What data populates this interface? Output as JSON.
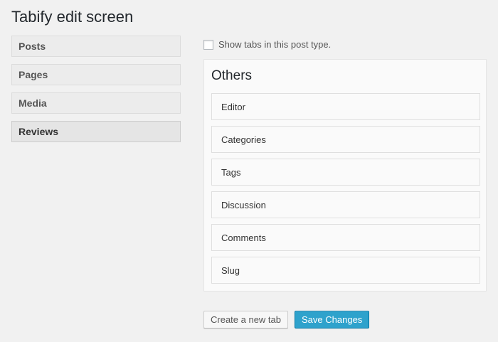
{
  "page": {
    "title": "Tabify edit screen"
  },
  "post_types": [
    {
      "label": "Posts",
      "active": false
    },
    {
      "label": "Pages",
      "active": false
    },
    {
      "label": "Media",
      "active": false
    },
    {
      "label": "Reviews",
      "active": true
    }
  ],
  "show_tabs": {
    "label": "Show tabs in this post type.",
    "checked": false
  },
  "tab": {
    "title": "Others",
    "items": [
      "Editor",
      "Categories",
      "Tags",
      "Discussion",
      "Comments",
      "Slug"
    ]
  },
  "actions": {
    "create_label": "Create a new tab",
    "save_label": "Save Changes"
  },
  "colors": {
    "primary": "#2ea2cc",
    "background": "#f1f1f1"
  }
}
